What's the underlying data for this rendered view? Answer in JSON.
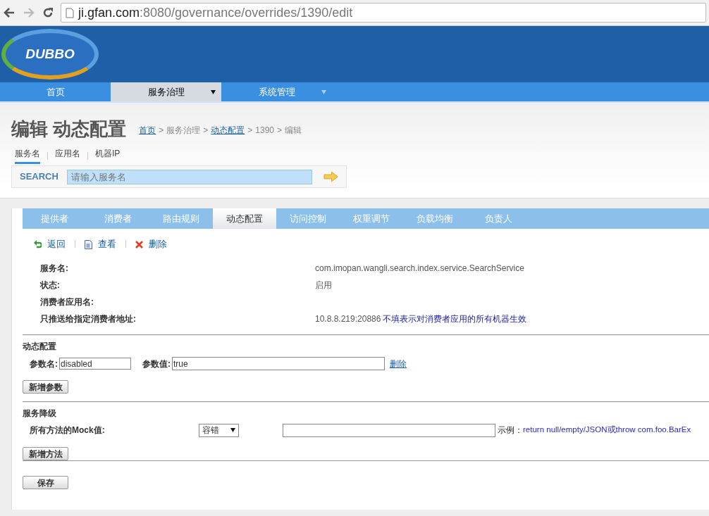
{
  "browser": {
    "url_host": "ji.gfan.com",
    "url_path": ":8080/governance/overrides/1390/edit"
  },
  "header": {
    "logo": "DUBBO"
  },
  "nav": [
    {
      "label": "首页",
      "selected": false,
      "dropdown": false
    },
    {
      "label": "服务治理",
      "selected": true,
      "dropdown": true
    },
    {
      "label": "系统管理",
      "selected": false,
      "dropdown": true
    }
  ],
  "page_title": "编辑 动态配置",
  "breadcrumb_separator": ">",
  "breadcrumb": [
    {
      "label": "首页",
      "link": true
    },
    {
      "label": "服务治理",
      "link": false
    },
    {
      "label": "动态配置",
      "link": true
    },
    {
      "label": "1390",
      "link": false
    },
    {
      "label": "编辑",
      "link": false
    }
  ],
  "search_tabs": [
    {
      "label": "服务名",
      "selected": true
    },
    {
      "label": "应用名",
      "selected": false
    },
    {
      "label": "机器IP",
      "selected": false
    }
  ],
  "search": {
    "label": "SEARCH",
    "placeholder": "请输入服务名"
  },
  "tabs": [
    {
      "label": "提供者",
      "selected": false
    },
    {
      "label": "消费者",
      "selected": false
    },
    {
      "label": "路由规则",
      "selected": false
    },
    {
      "label": "动态配置",
      "selected": true
    },
    {
      "label": "访问控制",
      "selected": false
    },
    {
      "label": "权重调节",
      "selected": false
    },
    {
      "label": "负载均衡",
      "selected": false
    },
    {
      "label": "负责人",
      "selected": false
    }
  ],
  "actions": [
    {
      "kind": "back",
      "label": "返回"
    },
    {
      "kind": "view",
      "label": "查看"
    },
    {
      "kind": "delete",
      "label": "删除"
    }
  ],
  "details": [
    {
      "label": "服务名:",
      "value": "com.imopan.wangli.search.index.service.SearchService"
    },
    {
      "label": "状态:",
      "value": "启用"
    },
    {
      "label": "消费者应用名:"
    },
    {
      "label": "只推送给指定消费者地址:",
      "value": "10.8.8.219:20886",
      "note": "不填表示对消费者应用的所有机器生效"
    }
  ],
  "override_section": {
    "title": "动态配置",
    "params": [
      {
        "name_label": "参数名:",
        "name": "disabled",
        "value_label": "参数值:",
        "value": "true",
        "delete": "删除"
      }
    ],
    "add_button": "新增参数"
  },
  "degrade_section": {
    "title": "服务降级",
    "label": "所有方法的Mock值:",
    "select": "容错",
    "example_label": "示例：",
    "example": "return null/empty/JSON或throw com.foo.BarEx",
    "add_button": "新增方法"
  },
  "save_button": "保存"
}
